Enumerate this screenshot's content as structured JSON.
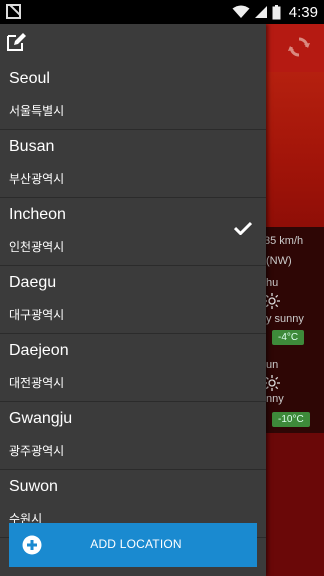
{
  "status_bar": {
    "time": "4:39"
  },
  "background_weather": {
    "wind_speed": "35 km/h",
    "wind_direction": "(NW)",
    "day1": "hu",
    "day1_condition": "y sunny",
    "day1_temp": "-4°C",
    "day2": "un",
    "day2_condition": "nny",
    "day2_temp": "-10°C",
    "accent_color": "#b51a12"
  },
  "drawer": {
    "locations": [
      {
        "name": "Seoul",
        "korean": "서울특별시",
        "selected": false
      },
      {
        "name": "Busan",
        "korean": "부산광역시",
        "selected": false
      },
      {
        "name": "Incheon",
        "korean": "인천광역시",
        "selected": true
      },
      {
        "name": "Daegu",
        "korean": "대구광역시",
        "selected": false
      },
      {
        "name": "Daejeon",
        "korean": "대전광역시",
        "selected": false
      },
      {
        "name": "Gwangju",
        "korean": "광주광역시",
        "selected": false
      },
      {
        "name": "Suwon",
        "korean": "수원시",
        "selected": false
      }
    ],
    "add_button_label": "ADD LOCATION",
    "add_button_color": "#1a8ad0",
    "icons": {
      "edit": "edit-icon",
      "check": "check-icon",
      "plus": "plus-circle-icon"
    }
  }
}
